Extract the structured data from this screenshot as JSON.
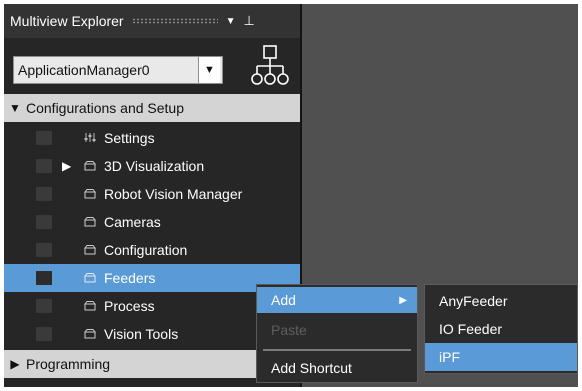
{
  "explorer": {
    "title": "Multiview Explorer",
    "dropdown_icon": "chevron-down-icon",
    "pin_icon": "pin-icon",
    "application_selector": {
      "value": "ApplicationManager0",
      "icon": "chevron-down-icon"
    },
    "hierarchy_icon": "hierarchy-icon"
  },
  "tree": {
    "configurations_group": {
      "label": "Configurations and Setup",
      "expanded": true,
      "items": [
        {
          "label": "Settings",
          "icon": "settings-icon",
          "expandable": false,
          "selected": false
        },
        {
          "label": "3D Visualization",
          "icon": "folder-icon",
          "expandable": true,
          "selected": false
        },
        {
          "label": "Robot Vision Manager",
          "icon": "folder-icon",
          "expandable": false,
          "selected": false
        },
        {
          "label": "Cameras",
          "icon": "folder-icon",
          "expandable": false,
          "selected": false
        },
        {
          "label": "Configuration",
          "icon": "folder-icon",
          "expandable": false,
          "selected": false
        },
        {
          "label": "Feeders",
          "icon": "folder-icon",
          "expandable": false,
          "selected": true
        },
        {
          "label": "Process",
          "icon": "folder-icon",
          "expandable": false,
          "selected": false
        },
        {
          "label": "Vision Tools",
          "icon": "folder-icon",
          "expandable": false,
          "selected": false
        }
      ]
    },
    "programming_group": {
      "label": "Programming",
      "expanded": false
    }
  },
  "context_menu": {
    "add": "Add",
    "paste": "Paste",
    "paste_enabled": false,
    "add_shortcut": "Add Shortcut"
  },
  "add_submenu": {
    "items": [
      "AnyFeeder",
      "IO Feeder",
      "iPF"
    ],
    "highlighted": "iPF"
  },
  "colors": {
    "selection": "#5a9ad6",
    "panel_bg": "#262626",
    "workspace_bg": "#505050",
    "group_header_bg": "#d4d4d4"
  }
}
